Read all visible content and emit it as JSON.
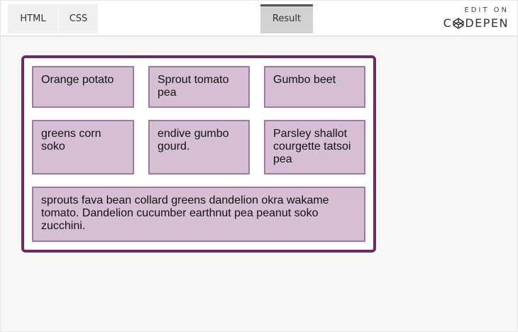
{
  "tabs": {
    "html": "HTML",
    "css": "CSS",
    "result": "Result"
  },
  "codepen": {
    "edit_on": "EDIT ON",
    "brand_left": "C",
    "brand_right": "DEPEN"
  },
  "grid": {
    "items": [
      "Orange potato",
      "Sprout tomato pea",
      "Gumbo beet",
      "greens corn soko",
      "endive gumbo gourd.",
      "Parsley shallot courgette tatsoi pea",
      "sprouts fava bean collard greens dandelion okra wakame tomato. Dandelion cucumber earthnut pea peanut soko zucchini."
    ]
  },
  "colors": {
    "container_border": "#6d2b66",
    "box_fill": "#d6bfd4",
    "box_border": "#a07a9e"
  }
}
